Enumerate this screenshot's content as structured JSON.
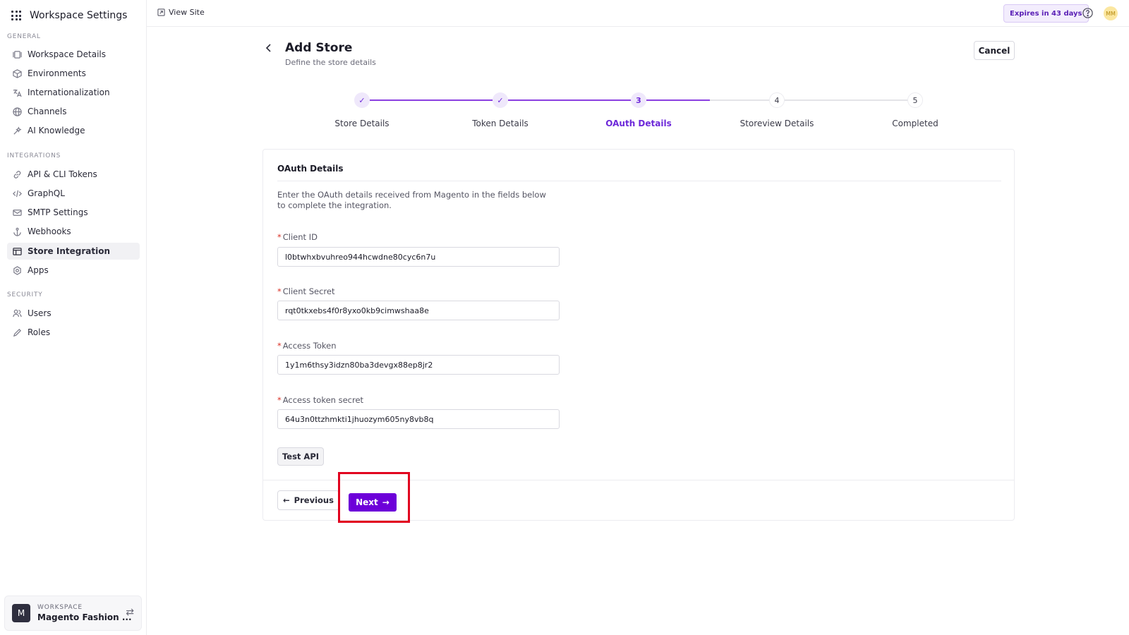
{
  "app": {
    "title": "Workspace Settings"
  },
  "sidebar": {
    "sections": [
      {
        "label": "GENERAL"
      },
      {
        "label": "INTEGRATIONS"
      },
      {
        "label": "SECURITY"
      }
    ],
    "items": [
      {
        "label": "Workspace Details",
        "icon": "workspace-icon"
      },
      {
        "label": "Environments",
        "icon": "cube-icon"
      },
      {
        "label": "Internationalization",
        "icon": "translate-icon"
      },
      {
        "label": "Channels",
        "icon": "globe-icon"
      },
      {
        "label": "AI Knowledge",
        "icon": "sparkle-icon"
      },
      {
        "label": "API & CLI Tokens",
        "icon": "link-icon"
      },
      {
        "label": "GraphQL",
        "icon": "code-icon"
      },
      {
        "label": "SMTP Settings",
        "icon": "mail-icon"
      },
      {
        "label": "Webhooks",
        "icon": "anchor-icon"
      },
      {
        "label": "Store Integration",
        "icon": "store-icon",
        "active": true
      },
      {
        "label": "Apps",
        "icon": "apps-icon"
      },
      {
        "label": "Users",
        "icon": "users-icon"
      },
      {
        "label": "Roles",
        "icon": "pen-icon"
      }
    ],
    "workspace": {
      "label": "WORKSPACE",
      "avatar": "M",
      "name": "Magento Fashion ..."
    }
  },
  "topbar": {
    "view_site": "View Site",
    "expires": "Expires in 43 days",
    "user_initials": "MM"
  },
  "page": {
    "title": "Add Store",
    "subtitle": "Define the store details",
    "cancel": "Cancel"
  },
  "stepper": {
    "steps": [
      {
        "label": "Store Details",
        "state": "done",
        "number": "1"
      },
      {
        "label": "Token Details",
        "state": "done",
        "number": "2"
      },
      {
        "label": "OAuth Details",
        "state": "current",
        "number": "3"
      },
      {
        "label": "Storeview Details",
        "state": "todo",
        "number": "4"
      },
      {
        "label": "Completed",
        "state": "todo",
        "number": "5"
      }
    ]
  },
  "form": {
    "title": "OAuth Details",
    "description": "Enter the OAuth details received from Magento in the fields below to complete the integration.",
    "required_mark": "*",
    "fields": [
      {
        "label": "Client ID",
        "value": "l0btwhxbvuhreo944hcwdne80cyc6n7u"
      },
      {
        "label": "Client Secret",
        "value": "rqt0tkxebs4f0r8yxo0kb9cimwshaa8e"
      },
      {
        "label": "Access Token",
        "value": "1y1m6thsy3idzn80ba3devgx88ep8jr2"
      },
      {
        "label": "Access token secret",
        "value": "64u3n0ttzhmkti1jhuozym605ny8vb8q"
      }
    ],
    "test_api": "Test API",
    "previous": "Previous",
    "next": "Next"
  },
  "colors": {
    "accent": "#6d00d9",
    "highlight": "#e1001f"
  }
}
